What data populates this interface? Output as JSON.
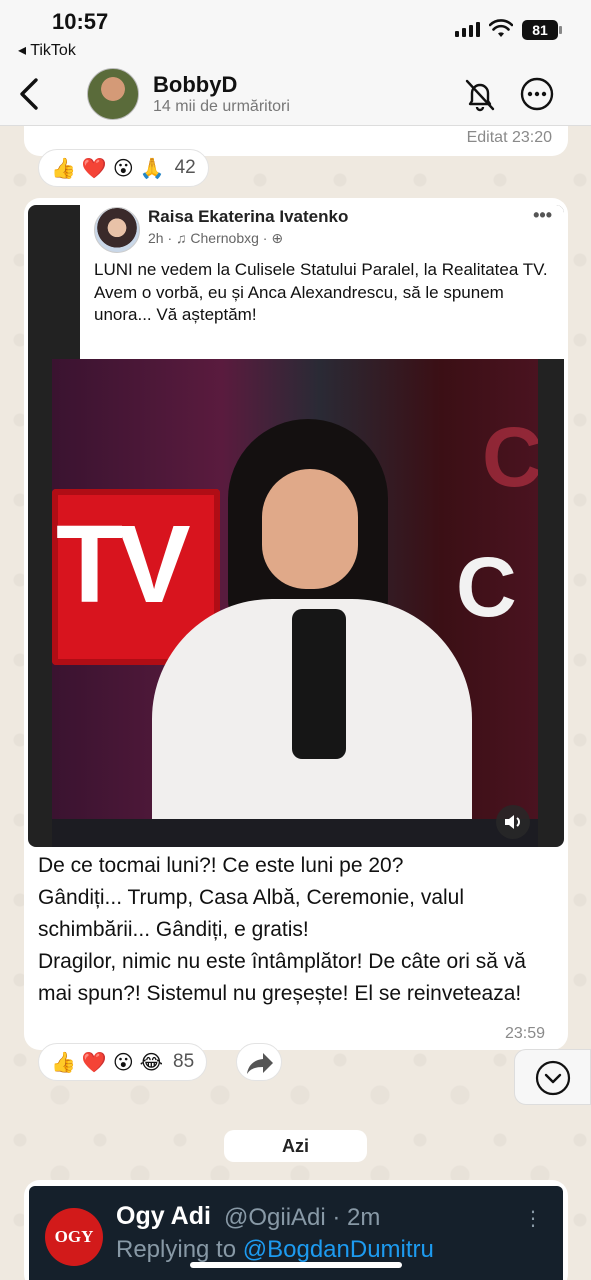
{
  "status_bar": {
    "time": "10:57",
    "back_app": "◂ TikTok",
    "battery": "81"
  },
  "header": {
    "channel_name": "BobbyD",
    "subtitle": "14 mii de urmăritori"
  },
  "previous_message": {
    "edited_label": "Editat 23:20",
    "reactions": [
      "👍",
      "❤️",
      "😮",
      "🙏"
    ],
    "reaction_count": "42"
  },
  "post": {
    "fb_author": "Raisa Ekaterina Ivatenko",
    "fb_meta": "2h · ♫ Chernobxg · ⊕",
    "fb_text": "LUNI ne vedem la Culisele Statului Paralel, la Realitatea TV. Avem o vorbă, eu și Anca Alexandrescu, să le spunem unora... Vă așteptăm!",
    "photo_sign_left": "TV",
    "photo_sign_right": "C",
    "caption_lines": [
      "De ce tocmai luni?! Ce este luni pe 20?",
      "Gândiți... Trump, Casa Albă, Ceremonie, valul schimbării... Gândiți, e gratis!",
      "Dragilor, nimic nu este întâmplător! De câte ori să vă mai spun?! Sistemul nu greșește! El se reinveteaza!"
    ],
    "time": "23:59",
    "reactions": [
      "👍",
      "❤️",
      "😮",
      "😂"
    ],
    "reaction_count": "85"
  },
  "date_separator": "Azi",
  "tweet": {
    "logo_text": "OGY",
    "name": "Ogy Adi",
    "handle": "@OgiiAdi · 2m",
    "reply_prefix": "Replying to ",
    "reply_to": "@BogdanDumitru"
  }
}
